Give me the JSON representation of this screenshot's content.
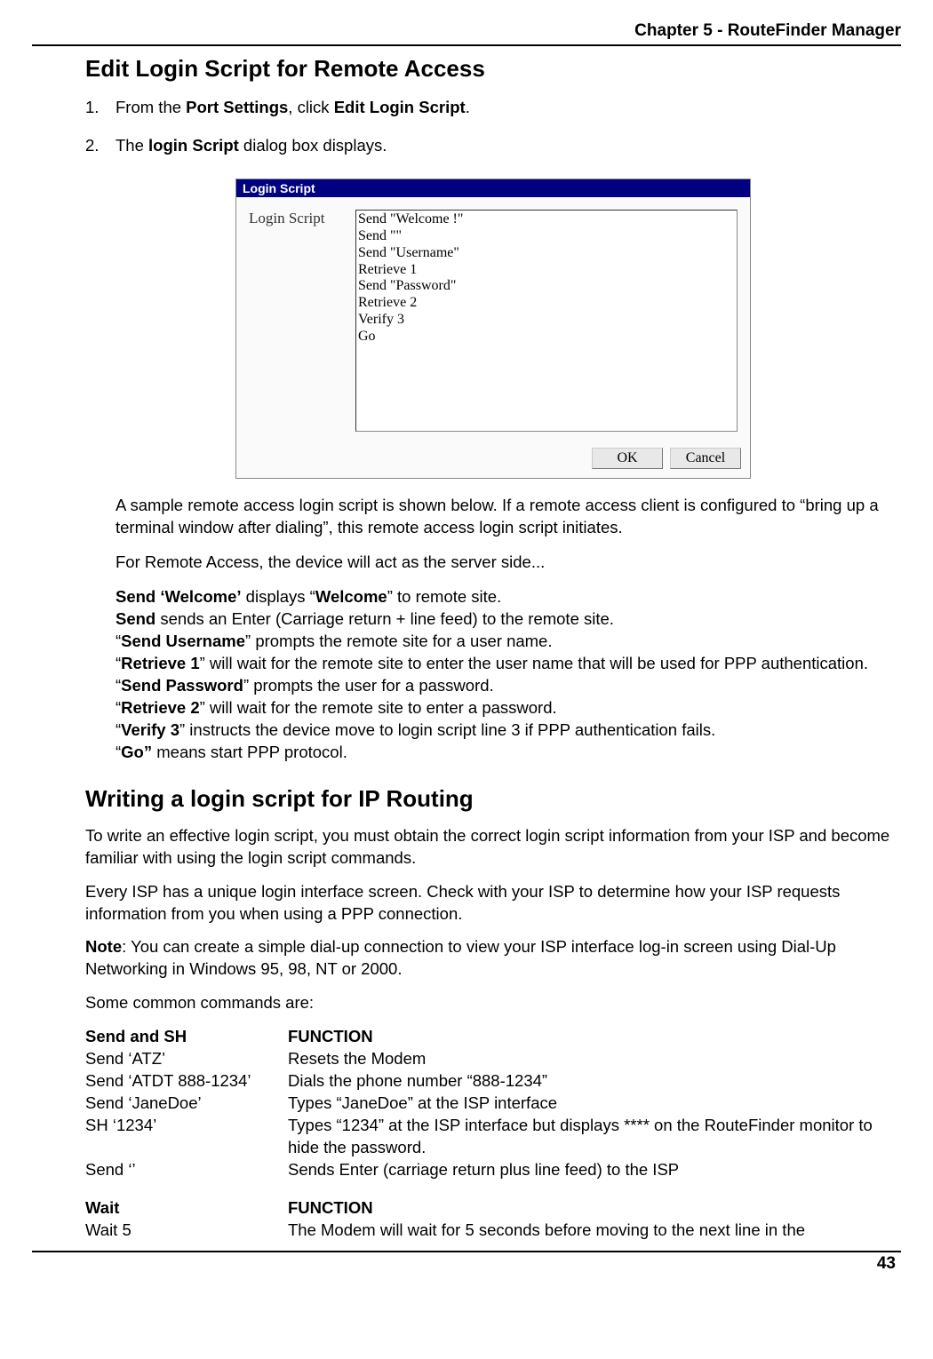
{
  "header": {
    "chapter": "Chapter 5 - RouteFinder Manager"
  },
  "section1": {
    "title": "Edit Login Script for Remote Access",
    "step1_num": "1.",
    "step1_pre": "From the ",
    "step1_b1": "Port Settings",
    "step1_mid": ", click ",
    "step1_b2": "Edit Login Script",
    "step1_post": ".",
    "step2_num": "2.",
    "step2_pre": "The ",
    "step2_b1": "login Script",
    "step2_post": " dialog box displays."
  },
  "dialog": {
    "title": "Login Script",
    "label": "Login Script",
    "text": "Send \"Welcome !\"\nSend \"\"\nSend \"Username\"\nRetrieve 1\nSend \"Password\"\nRetrieve 2\nVerify 3\nGo",
    "ok": "OK",
    "cancel": "Cancel"
  },
  "intro": {
    "p1": "A sample remote access login script is shown below.  If a remote access client is configured to “bring up a terminal window after dialing”, this remote access login script initiates.",
    "p2": "For Remote Access, the device will act as the server side..."
  },
  "explain": {
    "l1_b": "Send ‘Welcome’",
    "l1_t": " displays “",
    "l1_b2": "Welcome",
    "l1_t2": "” to remote site.",
    "l2_b": "Send",
    "l2_t": " sends an Enter (Carriage return + line feed) to the remote site.",
    "l3_pre": "“",
    "l3_b": "Send Username",
    "l3_t": "” prompts the remote site for a user name.",
    "l4_pre": "“",
    "l4_b": "Retrieve 1",
    "l4_t": "” will wait for the remote site to enter the user name that will be used for PPP authentication.",
    "l5_pre": "“",
    "l5_b": "Send Password",
    "l5_t": "” prompts the user for a password.",
    "l6_pre": "“",
    "l6_b": "Retrieve 2",
    "l6_t": "” will wait for the remote site to enter a password.",
    "l7_pre": "“",
    "l7_b": "Verify 3",
    "l7_t": "” instructs the device move to login script line 3 if PPP authentication fails.",
    "l8_pre": "“",
    "l8_b": "Go”",
    "l8_t": " means start PPP protocol."
  },
  "section2": {
    "title": "Writing a login script for IP Routing",
    "p1": "To write an effective login script, you must obtain the correct login script information from your ISP and become familiar with using the login script commands.",
    "p2": "Every ISP has a unique login interface screen.  Check with your ISP to determine how your ISP requests information from you when using a PPP connection.",
    "p3_b": "Note",
    "p3_t": ": You can create a simple dial-up connection to view your ISP interface log-in screen using Dial-Up Networking in Windows 95, 98, NT or 2000.",
    "p4": "Some common commands are:"
  },
  "table": {
    "h1_c1": "Send and SH",
    "h1_c2": "FUNCTION",
    "r1_c1": "Send ‘ATZ’",
    "r1_c2": "Resets the Modem",
    "r2_c1": "Send ‘ATDT 888-1234’",
    "r2_c2": "Dials the phone number “888-1234”",
    "r3_c1": "Send ‘JaneDoe’",
    "r3_c2": "Types “JaneDoe” at the ISP interface",
    "r4_c1": "SH ‘1234’",
    "r4_c2": "Types “1234” at the ISP interface but displays **** on the RouteFinder monitor to hide the password.",
    "r5_c1": "Send ‘’",
    "r5_c2": "Sends Enter (carriage return plus line feed) to the ISP",
    "h2_c1": "Wait",
    "h2_c2": "FUNCTION",
    "r6_c1": "Wait 5",
    "r6_c2": "The Modem will wait for 5 seconds before moving to the next line in the"
  },
  "footer": {
    "page": "43"
  }
}
